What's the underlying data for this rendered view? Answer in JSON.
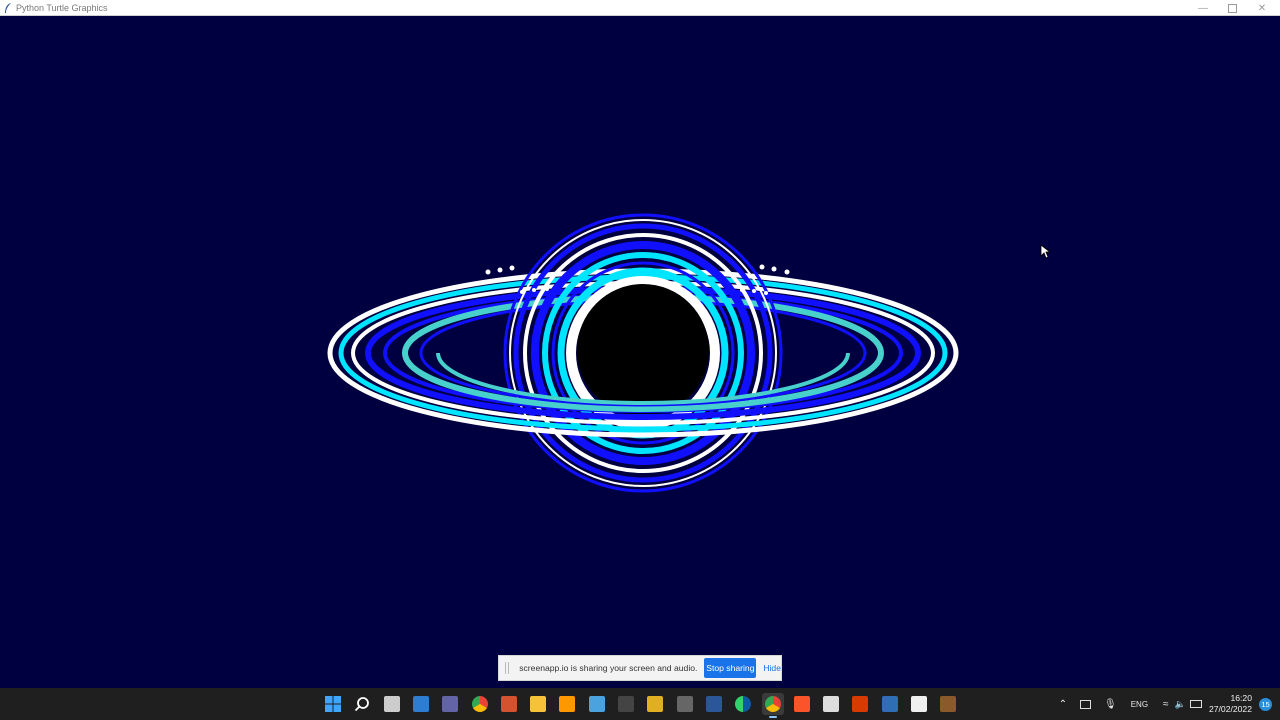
{
  "window": {
    "title": "Python Turtle Graphics",
    "icon": "feather-icon",
    "controls": [
      "minimize",
      "maximize",
      "close"
    ]
  },
  "canvas": {
    "background": "#000040",
    "ring_colors": [
      "#ffffff",
      "#00e5ff",
      "#1010ff",
      "#48d1cc"
    ],
    "core_color": "#000000"
  },
  "share_notice": {
    "message": "screenapp.io is sharing your screen and audio.",
    "stop_label": "Stop sharing",
    "hide_label": "Hide"
  },
  "taskbar": {
    "apps": [
      {
        "name": "start",
        "icon": "windows-icon",
        "color": "#3ea6ff"
      },
      {
        "name": "search",
        "icon": "search-icon",
        "color": "#ffffff"
      },
      {
        "name": "task-view",
        "icon": "task-view-icon",
        "color": "#cccccc"
      },
      {
        "name": "widgets",
        "icon": "widgets-icon",
        "color": "#2d7dd2"
      },
      {
        "name": "chat",
        "icon": "chat-icon",
        "color": "#6264a7"
      },
      {
        "name": "chrome-1",
        "icon": "chrome-icon",
        "color": "#4caf50"
      },
      {
        "name": "powerpoint",
        "icon": "powerpoint-icon",
        "color": "#d35230"
      },
      {
        "name": "file-explorer",
        "icon": "folder-icon",
        "color": "#f8c13a"
      },
      {
        "name": "sublime",
        "icon": "sublime-icon",
        "color": "#ff9800"
      },
      {
        "name": "photos",
        "icon": "photos-icon",
        "color": "#4aa3df"
      },
      {
        "name": "terminal",
        "icon": "terminal-icon",
        "color": "#444444"
      },
      {
        "name": "app-yellow",
        "icon": "yellow-app-icon",
        "color": "#e0b020"
      },
      {
        "name": "calculator",
        "icon": "calculator-icon",
        "color": "#666666"
      },
      {
        "name": "word",
        "icon": "word-icon",
        "color": "#2b579a"
      },
      {
        "name": "edge",
        "icon": "edge-icon",
        "color": "#1fa2e0"
      },
      {
        "name": "chrome-2",
        "icon": "chrome-icon",
        "color": "#4caf50",
        "active": true
      },
      {
        "name": "brave",
        "icon": "brave-icon",
        "color": "#fb542b"
      },
      {
        "name": "notepad",
        "icon": "notepad-icon",
        "color": "#dddddd"
      },
      {
        "name": "office",
        "icon": "office-icon",
        "color": "#d83b01"
      },
      {
        "name": "zotero",
        "icon": "zotero-icon",
        "color": "#2f6db5"
      },
      {
        "name": "document",
        "icon": "document-icon",
        "color": "#f0f0f0"
      },
      {
        "name": "minecraft",
        "icon": "minecraft-icon",
        "color": "#8b5a2b"
      }
    ],
    "tray": {
      "language": "ENG",
      "time": "16:20",
      "date": "27/02/2022",
      "notifications": "15"
    }
  }
}
